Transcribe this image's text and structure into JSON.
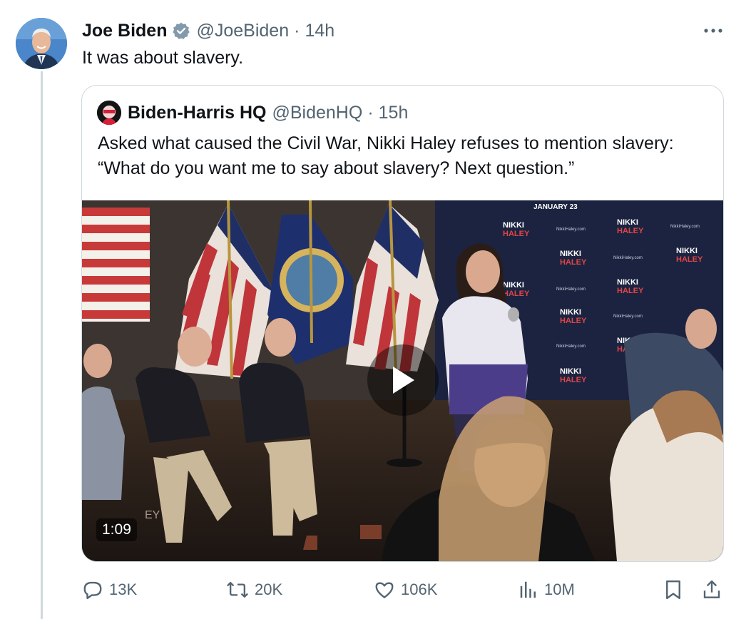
{
  "tweet": {
    "author_name": "Joe Biden",
    "handle": "@JoeBiden",
    "separator": "·",
    "time": "14h",
    "text": "It was about slavery.",
    "more_label": "•••"
  },
  "quoted": {
    "author_name": "Biden-Harris HQ",
    "handle": "@BidenHQ",
    "separator": "·",
    "time": "15h",
    "text": "Asked what caused the Civil War, Nikki Haley refuses to mention slavery: “What do you want me to say about slavery? Next question.”",
    "video": {
      "duration": "1:09",
      "sign_header": "JANUARY 23",
      "backdrop_brand_line1": "NIKKI",
      "backdrop_brand_line2": "HALEY",
      "backdrop_small": "NikkiHaley.com",
      "lectern_label": "EY"
    }
  },
  "actions": {
    "replies": "13K",
    "reposts": "20K",
    "likes": "106K",
    "views": "10M"
  },
  "colors": {
    "text": "#0f1419",
    "muted": "#536471",
    "verified": "#829aab",
    "border": "#cfd9de",
    "haley_red": "#d63a3a"
  }
}
